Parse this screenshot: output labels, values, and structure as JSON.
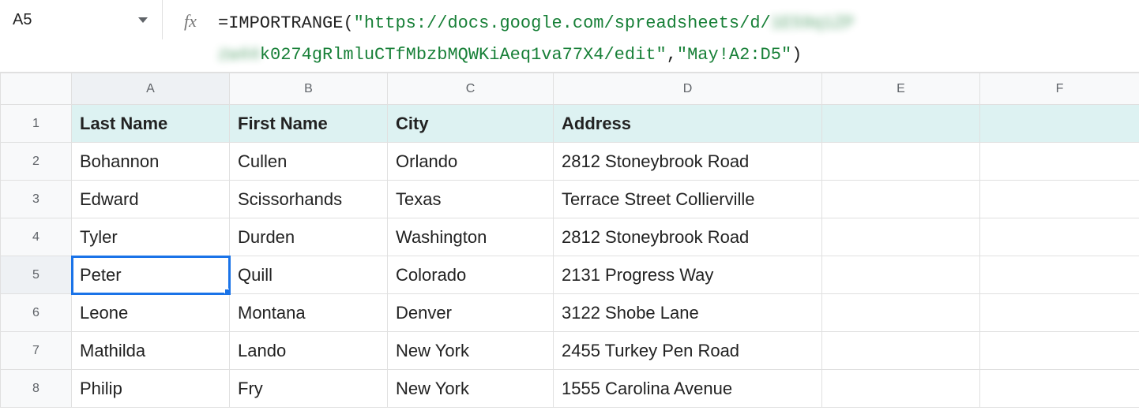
{
  "formula_bar": {
    "name_box": "A5",
    "fx_symbol": "fx",
    "formula_parts": {
      "eq": "=",
      "func": "IMPORTRANGE",
      "open": "(",
      "q1": "\"",
      "url_prefix": "https://docs.google.com/spreadsheets/d/",
      "blur1": "1E59q1ZP",
      "blur2": "zw44",
      "url_suffix": "k0274gRlmluCTfMbzbMQWKiAeq1va77X4/edit",
      "q2": "\"",
      "comma": ",",
      "q3": "\"",
      "range": "May!A2:D5",
      "q4": "\"",
      "close": ")"
    }
  },
  "columns": [
    "A",
    "B",
    "C",
    "D",
    "E",
    "F"
  ],
  "header_row": {
    "last_name": "Last Name",
    "first_name": "First Name",
    "city": "City",
    "address": "Address"
  },
  "rows": [
    {
      "n": "1"
    },
    {
      "n": "2",
      "last": "Bohannon",
      "first": "Cullen",
      "city": "Orlando",
      "addr": "2812 Stoneybrook Road"
    },
    {
      "n": "3",
      "last": "Edward",
      "first": "Scissorhands",
      "city": "Texas",
      "addr": "Terrace Street Collierville"
    },
    {
      "n": "4",
      "last": "Tyler",
      "first": "Durden",
      "city": "Washington",
      "addr": "2812 Stoneybrook Road"
    },
    {
      "n": "5",
      "last": "Peter",
      "first": "Quill",
      "city": "Colorado",
      "addr": "2131 Progress Way"
    },
    {
      "n": "6",
      "last": "Leone",
      "first": "Montana",
      "city": "Denver",
      "addr": "3122 Shobe Lane"
    },
    {
      "n": "7",
      "last": "Mathilda",
      "first": "Lando",
      "city": "New York",
      "addr": "2455 Turkey Pen Road"
    },
    {
      "n": "8",
      "last": "Philip",
      "first": "Fry",
      "city": "New York",
      "addr": "1555 Carolina Avenue"
    }
  ],
  "selected_cell": "A5"
}
